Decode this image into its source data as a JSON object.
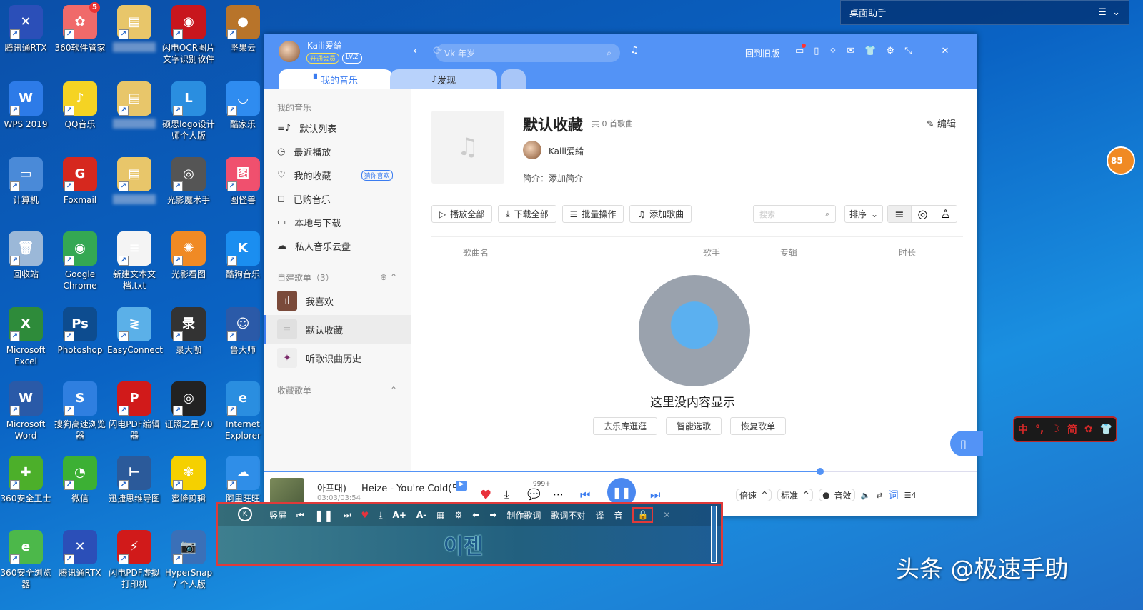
{
  "desktop_icons": [
    {
      "label": "腾讯通RTX",
      "color": "#2b4fb8",
      "glyph": "✕"
    },
    {
      "label": "360软件管家",
      "color": "#f06a6a",
      "glyph": "✿",
      "badge": "5"
    },
    {
      "label": "",
      "color": "#e8c66a",
      "glyph": "▤"
    },
    {
      "label": "闪电OCR图片文字识别软件",
      "color": "#c8161d",
      "glyph": "◉"
    },
    {
      "label": "坚果云",
      "color": "#b8742a",
      "glyph": "●"
    },
    {
      "label": "WPS 2019",
      "color": "#2d7be8",
      "glyph": "W"
    },
    {
      "label": "QQ音乐",
      "color": "#f5d323",
      "glyph": "♪"
    },
    {
      "label": "",
      "color": "#e8c66a",
      "glyph": "▤"
    },
    {
      "label": "硕思logo设计师个人版",
      "color": "#2a8ee0",
      "glyph": "L"
    },
    {
      "label": "酷家乐",
      "color": "#2f8cf0",
      "glyph": "◡"
    },
    {
      "label": "计算机",
      "color": "#4a8ad8",
      "glyph": "▭"
    },
    {
      "label": "Foxmail",
      "color": "#d6281e",
      "glyph": "G"
    },
    {
      "label": "",
      "color": "#e8c66a",
      "glyph": "▤"
    },
    {
      "label": "光影魔术手",
      "color": "#555",
      "glyph": "◎"
    },
    {
      "label": "图怪兽",
      "color": "#f0506e",
      "glyph": "图"
    },
    {
      "label": "回收站",
      "color": "#9bb8d8",
      "glyph": "🗑"
    },
    {
      "label": "Google Chrome",
      "color": "#34a853",
      "glyph": "◉"
    },
    {
      "label": "新建文本文档.txt",
      "color": "#f4f4f4",
      "glyph": "≡"
    },
    {
      "label": "光影看图",
      "color": "#f08a24",
      "glyph": "✺"
    },
    {
      "label": "酷狗音乐",
      "color": "#1b8ef0",
      "glyph": "K"
    },
    {
      "label": "Microsoft Excel",
      "color": "#2e8b3a",
      "glyph": "X"
    },
    {
      "label": "Photoshop",
      "color": "#0d4c8f",
      "glyph": "Ps"
    },
    {
      "label": "EasyConnect",
      "color": "#5bb0e8",
      "glyph": "≷"
    },
    {
      "label": "录大咖",
      "color": "#333",
      "glyph": "录"
    },
    {
      "label": "鲁大师",
      "color": "#2b5aa8",
      "glyph": "☺"
    },
    {
      "label": "Microsoft Word",
      "color": "#2a5aa8",
      "glyph": "W"
    },
    {
      "label": "搜狗高速浏览器",
      "color": "#2f7fe0",
      "glyph": "S"
    },
    {
      "label": "闪电PDF编辑器",
      "color": "#d11a1a",
      "glyph": "P"
    },
    {
      "label": "证照之星7.0",
      "color": "#222",
      "glyph": "◎"
    },
    {
      "label": "Internet Explorer",
      "color": "#2a8ee0",
      "glyph": "e"
    },
    {
      "label": "360安全卫士",
      "color": "#4caf2a",
      "glyph": "✚"
    },
    {
      "label": "微信",
      "color": "#3cb034",
      "glyph": "◔"
    },
    {
      "label": "迅捷思维导图",
      "color": "#2b5a9a",
      "glyph": "⊢"
    },
    {
      "label": "蜜蜂剪辑",
      "color": "#f5d000",
      "glyph": "✾"
    },
    {
      "label": "阿里旺旺",
      "color": "#2f8ee8",
      "glyph": "☁"
    },
    {
      "label": "360安全浏览器",
      "color": "#4cb84a",
      "glyph": "e"
    },
    {
      "label": "腾讯通RTX",
      "color": "#2b4fb8",
      "glyph": "✕"
    },
    {
      "label": "闪电PDF虚拟打印机",
      "color": "#d11a1a",
      "glyph": "⚡"
    },
    {
      "label": "HyperSnap 7 个人版",
      "color": "#3a70b8",
      "glyph": "📷"
    }
  ],
  "assistant": {
    "title": "桌面助手"
  },
  "float_badge": "85",
  "ime": {
    "items": [
      "中",
      "°,",
      "☽",
      "简",
      "✿",
      "👕"
    ]
  },
  "app": {
    "user": {
      "name": "Kaili爱綸",
      "vip": "开通会员",
      "level": "LV.2"
    },
    "search": {
      "placeholder": "Vk 年岁"
    },
    "old_version": "回到旧版",
    "tabs": [
      "我的音乐",
      "发现"
    ],
    "sidebar": {
      "section": "我的音乐",
      "items": [
        {
          "label": "默认列表",
          "icon": "list"
        },
        {
          "label": "最近播放",
          "icon": "clock"
        },
        {
          "label": "我的收藏",
          "icon": "heart",
          "tag": "猜你喜欢"
        },
        {
          "label": "已购音乐",
          "icon": "bag"
        },
        {
          "label": "本地与下载",
          "icon": "monitor"
        },
        {
          "label": "私人音乐云盘",
          "icon": "cloud"
        }
      ],
      "created": "自建歌单（3）",
      "playlists": [
        {
          "label": "我喜欢",
          "color": "#7a4a3a"
        },
        {
          "label": "默认收藏",
          "color": "#e6e6e6"
        },
        {
          "label": "听歌识曲历史",
          "color": "#f0f0f0"
        }
      ],
      "collected": "收藏歌单"
    },
    "playlist": {
      "title": "默认收藏",
      "count": "共 0 首歌曲",
      "owner": "Kaili爱綸",
      "intro": "简介：添加简介",
      "edit": "编辑"
    },
    "actions": [
      "播放全部",
      "下载全部",
      "批量操作",
      "添加歌曲"
    ],
    "list_search": "搜索",
    "sort": "排序",
    "columns": [
      "歌曲名",
      "歌手",
      "专辑",
      "时长"
    ],
    "empty": {
      "text": "这里没内容显示",
      "buttons": [
        "去乐库逛逛",
        "智能选歌",
        "恢复歌单"
      ]
    },
    "player": {
      "title": "아프대)",
      "song": "Heize - You're Cold(ᄃ",
      "comments": "999+",
      "time": "03:03/03:54",
      "progress": 0.78,
      "speed": "倍速",
      "quality": "标准",
      "effect": "音效",
      "lyric_btn": "词",
      "queue": "4"
    }
  },
  "lyrics_bar": {
    "buttons": [
      "竖屏",
      "A+",
      "A-",
      "制作歌词",
      "歌词不对",
      "译",
      "音"
    ],
    "line": "이젠"
  },
  "watermark": "头条 @极速手助"
}
